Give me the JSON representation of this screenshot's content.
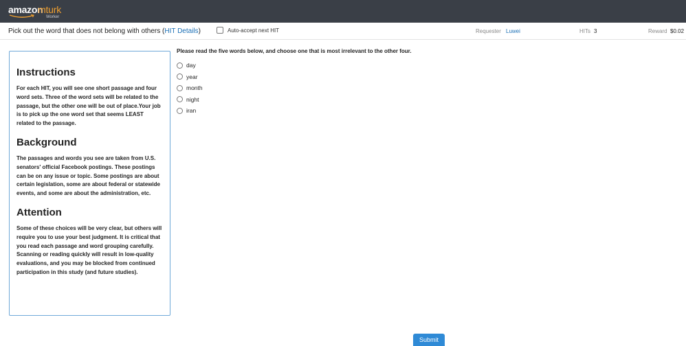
{
  "header": {
    "logo_primary": "amazon",
    "logo_secondary": "mturk",
    "logo_caption": "Worker",
    "brand_color": "#f0a030",
    "bar_color": "#3a3f47"
  },
  "hit_bar": {
    "title": "Pick out the word that does not belong with others (",
    "details_link": "HIT Details",
    "title_end": ")",
    "auto_accept_label": "Auto-accept next HIT",
    "requester_label": "Requester",
    "requester_value": "Luwei",
    "hits_label": "HITs",
    "hits_value": "3",
    "reward_label": "Reward",
    "reward_value": "$0.02"
  },
  "instructions": {
    "sections": [
      {
        "heading": "Instructions",
        "body": "For each HIT, you will see one short passage and four word sets. Three of the word sets will be related to the passage, but the other one will be out of place.Your job is to pick up the one word set that seems LEAST related to the passage."
      },
      {
        "heading": "Background",
        "body": "The passages and words you see are taken from U.S. senators' official Facebook postings. These postings can be on any issue or topic. Some postings are about certain legislation, some are about federal or statewide events, and some are about the administration, etc."
      },
      {
        "heading": "Attention",
        "body": "Some of these choices will be very clear, but others will require you to use your best judgment. It is critical that you read each passage and word grouping carefully. Scanning or reading quickly will result in low-quality evaluations, and you may be blocked from continued participation in this study (and future studies)."
      }
    ]
  },
  "task": {
    "prompt": "Please read the five words below, and choose one that is most irrelevant to the other four.",
    "options": [
      "day",
      "year",
      "month",
      "night",
      "iran"
    ]
  },
  "submit_label": "Submit",
  "accent_color": "#2f8ad6"
}
